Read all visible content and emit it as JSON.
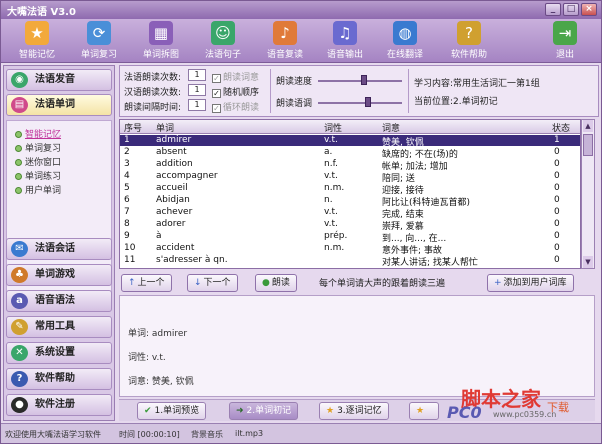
{
  "window": {
    "title": "大嘴法语 V3.0"
  },
  "toolbar": {
    "items": [
      {
        "label": "智能记忆",
        "icon": "memory-icon",
        "color": "#f2a93b"
      },
      {
        "label": "单词复习",
        "icon": "review-icon",
        "color": "#4a8fd8"
      },
      {
        "label": "单词拆图",
        "icon": "grid-icon",
        "color": "#8a5fb8"
      },
      {
        "label": "法语句子",
        "icon": "people-icon",
        "color": "#3aa66a"
      },
      {
        "label": "语音复读",
        "icon": "speaker-icon",
        "color": "#e07a3a"
      },
      {
        "label": "语音输出",
        "icon": "output-icon",
        "color": "#6a6ad0"
      },
      {
        "label": "在线翻译",
        "icon": "globe-icon",
        "color": "#3a7ad0"
      },
      {
        "label": "软件帮助",
        "icon": "help-icon",
        "color": "#d0a030"
      },
      {
        "label": "退出",
        "icon": "exit-icon",
        "color": "#4aa64a"
      }
    ]
  },
  "sidebar": {
    "top_items": [
      {
        "label": "法语发音",
        "icon": "mic-icon",
        "color": "#3aa66a"
      },
      {
        "label": "法语单词",
        "icon": "book-icon",
        "color": "#d04a8a"
      }
    ],
    "sub_items": [
      "智能记忆",
      "单词复习",
      "迷你窗口",
      "单词练习",
      "用户单词"
    ],
    "bottom_items": [
      {
        "label": "法语会话",
        "icon": "chat-icon",
        "color": "#3a7ad0"
      },
      {
        "label": "单词游戏",
        "icon": "game-icon",
        "color": "#d07a2a"
      },
      {
        "label": "语音语法",
        "icon": "abc-icon",
        "color": "#5a5ab2"
      },
      {
        "label": "常用工具",
        "icon": "tools-icon",
        "color": "#d0a030"
      },
      {
        "label": "系统设置",
        "icon": "settings-icon",
        "color": "#3aa66a"
      },
      {
        "label": "软件帮助",
        "icon": "help-icon",
        "color": "#3a5ab0"
      },
      {
        "label": "软件注册",
        "icon": "register-icon",
        "color": "#2a2a2a"
      }
    ]
  },
  "options": {
    "fr_count_label": "法语朗读次数:",
    "fr_count_value": "1",
    "cn_count_label": "汉语朗读次数:",
    "cn_count_value": "1",
    "interval_label": "朗读间隔时间:",
    "interval_value": "1",
    "chk_read_def": "朗读词意",
    "chk_random": "随机顺序",
    "chk_loop": "循环朗读",
    "speed_label": "朗读速度",
    "tone_label": "朗读语调",
    "speed_level": 0.55,
    "tone_level": 0.6,
    "content_label": "学习内容:",
    "content_value": "常用生活词汇一第1组",
    "position_label": "当前位置:",
    "position_value": "2.单词初记"
  },
  "table": {
    "headers": [
      "序号",
      "单词",
      "词性",
      "词意",
      "状态"
    ],
    "rows": [
      [
        "1",
        "admirer",
        "v.t.",
        "赞美, 钦佩",
        "1"
      ],
      [
        "2",
        "absent",
        "a.",
        "缺席的; 不在(场)的",
        "0"
      ],
      [
        "3",
        "addition",
        "n.f.",
        "帐单; 加法; 增加",
        "0"
      ],
      [
        "4",
        "accompagner",
        "v.t.",
        "陪同; 送",
        "0"
      ],
      [
        "5",
        "accueil",
        "n.m.",
        "迎接, 接待",
        "0"
      ],
      [
        "6",
        "Abidjan",
        "n.",
        "阿比让(科特迪瓦首都)",
        "0"
      ],
      [
        "7",
        "achever",
        "v.t.",
        "完成, 结束",
        "0"
      ],
      [
        "8",
        "adorer",
        "v.t.",
        "崇拜, 爱慕",
        "0"
      ],
      [
        "9",
        "à",
        "prép.",
        "到..., 向..., 在...",
        "0"
      ],
      [
        "10",
        "accident",
        "n.m.",
        "意外事件; 事故",
        "0"
      ],
      [
        "11",
        "s'adresser à qn.",
        "",
        "对某人讲话; 找某人帮忙",
        "0"
      ]
    ]
  },
  "controls": {
    "prev": "上一个",
    "next": "下一个",
    "read": "朗读",
    "hint": "每个单词请大声的跟着朗读三遍",
    "add_user": "添加到用户词库"
  },
  "detail": {
    "word_line": "单词: admirer",
    "pos_line": "词性: v.t.",
    "meaning_line": "词意: 赞美, 钦佩"
  },
  "steps": [
    "1.单词预览",
    "2.单词初记",
    "3.逐词记忆"
  ],
  "status": {
    "welcome": "欢迎使用大嘴法语学习软件",
    "time": "时间 [00:00:10]",
    "music": "背景音乐",
    "file": "ilt.mp3"
  },
  "watermark": {
    "top": "脚本之家",
    "logo": "PC0",
    "url": "www.pc0359.cn",
    "dl": "下载"
  }
}
